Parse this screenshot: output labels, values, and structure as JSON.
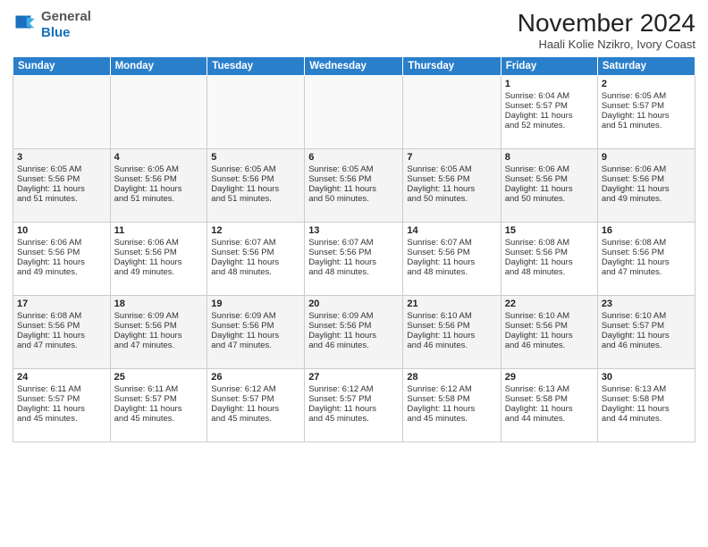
{
  "header": {
    "logo_line1": "General",
    "logo_line2": "Blue",
    "month_year": "November 2024",
    "location": "Haali Kolie Nzikro, Ivory Coast"
  },
  "weekdays": [
    "Sunday",
    "Monday",
    "Tuesday",
    "Wednesday",
    "Thursday",
    "Friday",
    "Saturday"
  ],
  "weeks": [
    [
      {
        "day": "",
        "info": ""
      },
      {
        "day": "",
        "info": ""
      },
      {
        "day": "",
        "info": ""
      },
      {
        "day": "",
        "info": ""
      },
      {
        "day": "",
        "info": ""
      },
      {
        "day": "1",
        "info": "Sunrise: 6:04 AM\nSunset: 5:57 PM\nDaylight: 11 hours\nand 52 minutes."
      },
      {
        "day": "2",
        "info": "Sunrise: 6:05 AM\nSunset: 5:57 PM\nDaylight: 11 hours\nand 51 minutes."
      }
    ],
    [
      {
        "day": "3",
        "info": "Sunrise: 6:05 AM\nSunset: 5:56 PM\nDaylight: 11 hours\nand 51 minutes."
      },
      {
        "day": "4",
        "info": "Sunrise: 6:05 AM\nSunset: 5:56 PM\nDaylight: 11 hours\nand 51 minutes."
      },
      {
        "day": "5",
        "info": "Sunrise: 6:05 AM\nSunset: 5:56 PM\nDaylight: 11 hours\nand 51 minutes."
      },
      {
        "day": "6",
        "info": "Sunrise: 6:05 AM\nSunset: 5:56 PM\nDaylight: 11 hours\nand 50 minutes."
      },
      {
        "day": "7",
        "info": "Sunrise: 6:05 AM\nSunset: 5:56 PM\nDaylight: 11 hours\nand 50 minutes."
      },
      {
        "day": "8",
        "info": "Sunrise: 6:06 AM\nSunset: 5:56 PM\nDaylight: 11 hours\nand 50 minutes."
      },
      {
        "day": "9",
        "info": "Sunrise: 6:06 AM\nSunset: 5:56 PM\nDaylight: 11 hours\nand 49 minutes."
      }
    ],
    [
      {
        "day": "10",
        "info": "Sunrise: 6:06 AM\nSunset: 5:56 PM\nDaylight: 11 hours\nand 49 minutes."
      },
      {
        "day": "11",
        "info": "Sunrise: 6:06 AM\nSunset: 5:56 PM\nDaylight: 11 hours\nand 49 minutes."
      },
      {
        "day": "12",
        "info": "Sunrise: 6:07 AM\nSunset: 5:56 PM\nDaylight: 11 hours\nand 48 minutes."
      },
      {
        "day": "13",
        "info": "Sunrise: 6:07 AM\nSunset: 5:56 PM\nDaylight: 11 hours\nand 48 minutes."
      },
      {
        "day": "14",
        "info": "Sunrise: 6:07 AM\nSunset: 5:56 PM\nDaylight: 11 hours\nand 48 minutes."
      },
      {
        "day": "15",
        "info": "Sunrise: 6:08 AM\nSunset: 5:56 PM\nDaylight: 11 hours\nand 48 minutes."
      },
      {
        "day": "16",
        "info": "Sunrise: 6:08 AM\nSunset: 5:56 PM\nDaylight: 11 hours\nand 47 minutes."
      }
    ],
    [
      {
        "day": "17",
        "info": "Sunrise: 6:08 AM\nSunset: 5:56 PM\nDaylight: 11 hours\nand 47 minutes."
      },
      {
        "day": "18",
        "info": "Sunrise: 6:09 AM\nSunset: 5:56 PM\nDaylight: 11 hours\nand 47 minutes."
      },
      {
        "day": "19",
        "info": "Sunrise: 6:09 AM\nSunset: 5:56 PM\nDaylight: 11 hours\nand 47 minutes."
      },
      {
        "day": "20",
        "info": "Sunrise: 6:09 AM\nSunset: 5:56 PM\nDaylight: 11 hours\nand 46 minutes."
      },
      {
        "day": "21",
        "info": "Sunrise: 6:10 AM\nSunset: 5:56 PM\nDaylight: 11 hours\nand 46 minutes."
      },
      {
        "day": "22",
        "info": "Sunrise: 6:10 AM\nSunset: 5:56 PM\nDaylight: 11 hours\nand 46 minutes."
      },
      {
        "day": "23",
        "info": "Sunrise: 6:10 AM\nSunset: 5:57 PM\nDaylight: 11 hours\nand 46 minutes."
      }
    ],
    [
      {
        "day": "24",
        "info": "Sunrise: 6:11 AM\nSunset: 5:57 PM\nDaylight: 11 hours\nand 45 minutes."
      },
      {
        "day": "25",
        "info": "Sunrise: 6:11 AM\nSunset: 5:57 PM\nDaylight: 11 hours\nand 45 minutes."
      },
      {
        "day": "26",
        "info": "Sunrise: 6:12 AM\nSunset: 5:57 PM\nDaylight: 11 hours\nand 45 minutes."
      },
      {
        "day": "27",
        "info": "Sunrise: 6:12 AM\nSunset: 5:57 PM\nDaylight: 11 hours\nand 45 minutes."
      },
      {
        "day": "28",
        "info": "Sunrise: 6:12 AM\nSunset: 5:58 PM\nDaylight: 11 hours\nand 45 minutes."
      },
      {
        "day": "29",
        "info": "Sunrise: 6:13 AM\nSunset: 5:58 PM\nDaylight: 11 hours\nand 44 minutes."
      },
      {
        "day": "30",
        "info": "Sunrise: 6:13 AM\nSunset: 5:58 PM\nDaylight: 11 hours\nand 44 minutes."
      }
    ]
  ]
}
